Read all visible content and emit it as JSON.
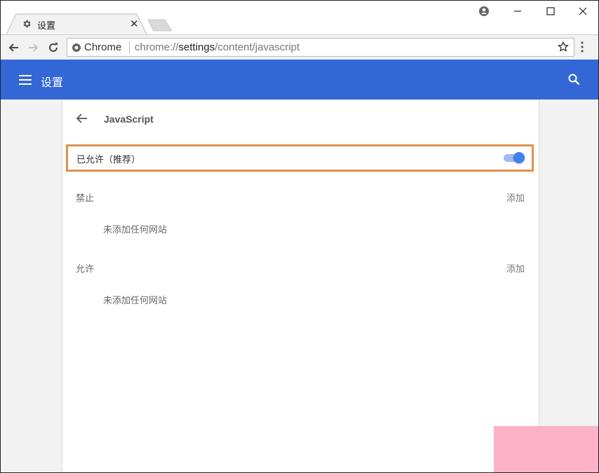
{
  "browser": {
    "tab": {
      "title": "设置",
      "icon": "gear-icon"
    },
    "window_controls": [
      "profile-icon",
      "minimize-icon",
      "maximize-icon",
      "close-icon"
    ],
    "omnibox": {
      "chip": "Chrome",
      "url_prefix": "chrome://",
      "url_host": "settings",
      "url_path": "/content/javascript"
    }
  },
  "header": {
    "title": "设置"
  },
  "page": {
    "title": "JavaScript",
    "allowed_row": {
      "label": "已允许（推荐）",
      "toggle_on": true
    },
    "sections": [
      {
        "label": "禁止",
        "add_label": "添加",
        "empty_text": "未添加任何网站"
      },
      {
        "label": "允许",
        "add_label": "添加",
        "empty_text": "未添加任何网站"
      }
    ]
  },
  "colors": {
    "header": "#3367d6",
    "highlight": "#e0914e",
    "toggle": "#3f80f0"
  }
}
